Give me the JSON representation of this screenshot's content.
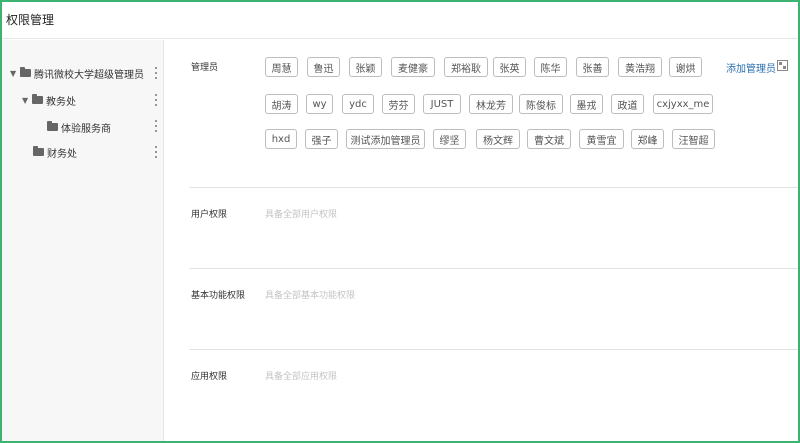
{
  "window": {
    "title": "权限管理"
  },
  "tree": {
    "root": {
      "label": "腾讯微校大学超级管理员"
    },
    "child1": {
      "label": "教务处"
    },
    "grandchild1": {
      "label": "体验服务商"
    },
    "child2": {
      "label": "财务处"
    }
  },
  "admins": {
    "label": "管理员",
    "add_label": "添加管理员",
    "names": [
      "周慧",
      "鲁迅",
      "张颖",
      "麦健豪",
      "郑裕耿",
      "张英",
      "陈华",
      "张善",
      "黄浩翔",
      "谢烘",
      "胡涛",
      "wy",
      "ydc",
      "劳芬",
      "JUST",
      "林龙芳",
      "陈俊标",
      "墨戎",
      "政道",
      "cxjyxx_me",
      "hxd",
      "强子",
      "测试添加管理员",
      "缪坚",
      "杨文辉",
      "曹文斌",
      "黄雪宜",
      "郑峰",
      "汪智超"
    ]
  },
  "user_perm": {
    "label": "用户权限",
    "hint": "具备全部用户权限"
  },
  "basic_perm": {
    "label": "基本功能权限",
    "hint": "具备全部基本功能权限"
  },
  "app_perm": {
    "label": "应用权限",
    "hint": "具备全部应用权限"
  }
}
